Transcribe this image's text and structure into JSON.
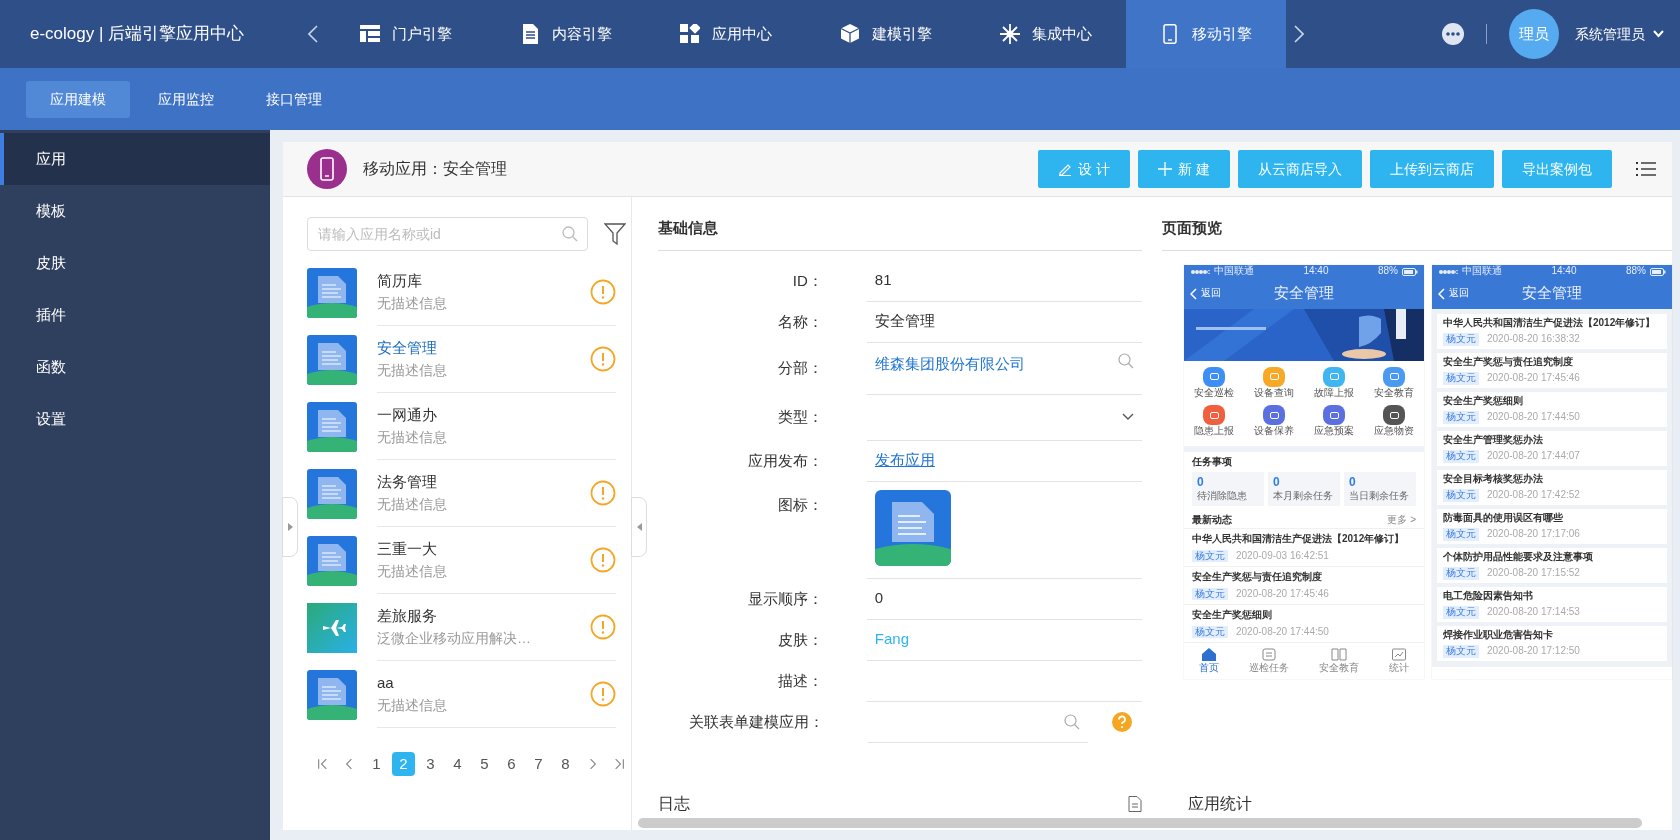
{
  "topbar": {
    "brand": "e-cology | 后端引擎应用中心",
    "avatar": "理员",
    "user": "系统管理员",
    "nav": [
      {
        "label": "门户引擎",
        "selected": false
      },
      {
        "label": "内容引擎",
        "selected": false
      },
      {
        "label": "应用中心",
        "selected": false
      },
      {
        "label": "建模引擎",
        "selected": false
      },
      {
        "label": "集成中心",
        "selected": false
      },
      {
        "label": "移动引擎",
        "selected": true
      }
    ]
  },
  "subnav": [
    {
      "label": "应用建模",
      "selected": true
    },
    {
      "label": "应用监控",
      "selected": false
    },
    {
      "label": "接口管理",
      "selected": false
    }
  ],
  "sidebar": [
    {
      "label": "应用",
      "selected": true
    },
    {
      "label": "模板",
      "selected": false
    },
    {
      "label": "皮肤",
      "selected": false
    },
    {
      "label": "插件",
      "selected": false
    },
    {
      "label": "函数",
      "selected": false
    },
    {
      "label": "设置",
      "selected": false
    }
  ],
  "header": {
    "title": "移动应用：安全管理",
    "buttons": [
      {
        "label": "设 计",
        "kind": "edit"
      },
      {
        "label": "新 建",
        "kind": "add"
      },
      {
        "label": "从云商店导入",
        "kind": "plain"
      },
      {
        "label": "上传到云商店",
        "kind": "plain"
      },
      {
        "label": "导出案例包",
        "kind": "plain"
      }
    ]
  },
  "app_list": {
    "placeholder": "请输入应用名称或id",
    "items": [
      {
        "name": "简历库",
        "desc": "无描述信息",
        "selected": false,
        "kind": "document",
        "warning": true
      },
      {
        "name": "安全管理",
        "desc": "无描述信息",
        "selected": true,
        "kind": "document",
        "warning": true
      },
      {
        "name": "一网通办",
        "desc": "无描述信息",
        "selected": false,
        "kind": "document",
        "warning": false
      },
      {
        "name": "法务管理",
        "desc": "无描述信息",
        "selected": false,
        "kind": "document",
        "warning": true
      },
      {
        "name": "三重一大",
        "desc": "无描述信息",
        "selected": false,
        "kind": "document",
        "warning": true
      },
      {
        "name": "差旅服务",
        "desc": "泛微企业移动应用解决…",
        "selected": false,
        "kind": "plane",
        "warning": true
      },
      {
        "name": "aa",
        "desc": "无描述信息",
        "selected": false,
        "kind": "document",
        "warning": true
      }
    ],
    "pages": [
      {
        "label": "1",
        "selected": false
      },
      {
        "label": "2",
        "selected": true
      },
      {
        "label": "3",
        "selected": false
      },
      {
        "label": "4",
        "selected": false
      },
      {
        "label": "5",
        "selected": false
      },
      {
        "label": "6",
        "selected": false
      },
      {
        "label": "7",
        "selected": false
      },
      {
        "label": "8",
        "selected": false
      }
    ]
  },
  "basic_info": {
    "title": "基础信息",
    "fields": [
      {
        "label": "ID：",
        "kind": "text",
        "value": "81"
      },
      {
        "label": "名称：",
        "kind": "text",
        "value": "安全管理"
      },
      {
        "label": "分部：",
        "kind": "browse",
        "value": "维森集团股份有限公司"
      },
      {
        "label": "类型：",
        "kind": "select"
      },
      {
        "label": "应用发布：",
        "kind": "link",
        "value": "发布应用"
      },
      {
        "label": "图标：",
        "kind": "icon"
      },
      {
        "label": "显示顺序：",
        "kind": "text",
        "value": "0"
      },
      {
        "label": "皮肤：",
        "kind": "skin",
        "value": "Fang"
      },
      {
        "label": "描述：",
        "kind": "text"
      },
      {
        "label": "关联表单建模应用：",
        "kind": "lookup"
      }
    ]
  },
  "preview": {
    "title": "页面预览",
    "phones": [
      {
        "kind": "home",
        "carrier": "中国联通",
        "time": "14:40",
        "battery": "88%",
        "back": "返回",
        "title": "安全管理",
        "shortcuts": [
          {
            "label": "安全巡检",
            "color": "#3d8ef5"
          },
          {
            "label": "设备查询",
            "color": "#f7a827"
          },
          {
            "label": "故障上报",
            "color": "#3fb6f2"
          },
          {
            "label": "安全教育",
            "color": "#4a9af2"
          },
          {
            "label": "隐患上报",
            "color": "#f0603e"
          },
          {
            "label": "设备保养",
            "color": "#5a6fe0"
          },
          {
            "label": "应急预案",
            "color": "#5a6fe0"
          },
          {
            "label": "应急物资",
            "color": "#555555"
          }
        ],
        "tasks_title": "任务事项",
        "tasks": [
          {
            "count": "0",
            "label": "待消除隐患"
          },
          {
            "count": "0",
            "label": "本月剩余任务"
          },
          {
            "count": "0",
            "label": "当日剩余任务"
          }
        ],
        "news_title": "最新动态",
        "more": "更多 >",
        "news": [
          {
            "title": "中华人民共和国清洁生产促进法【2012年修订】",
            "author": "杨文元",
            "date": "2020-09-03 16:42:51"
          },
          {
            "title": "安全生产奖惩与责任追究制度",
            "author": "杨文元",
            "date": "2020-08-20 17:45:46"
          },
          {
            "title": "安全生产奖惩细则",
            "author": "杨文元",
            "date": "2020-08-20 17:44:50"
          }
        ],
        "tabs": [
          {
            "label": "首页",
            "selected": true
          },
          {
            "label": "巡检任务",
            "selected": false
          },
          {
            "label": "安全教育",
            "selected": false
          },
          {
            "label": "统计",
            "selected": false
          }
        ]
      },
      {
        "kind": "list",
        "carrier": "中国联通",
        "time": "14:40",
        "battery": "88%",
        "back": "返回",
        "title": "安全管理",
        "news": [
          {
            "title": "中华人民共和国清洁生产促进法【2012年修订】",
            "author": "杨文元",
            "date": "2020-08-20 16:38:32"
          },
          {
            "title": "安全生产奖惩与责任追究制度",
            "author": "杨文元",
            "date": "2020-08-20 17:45:46"
          },
          {
            "title": "安全生产奖惩细则",
            "author": "杨文元",
            "date": "2020-08-20 17:44:50"
          },
          {
            "title": "安全生产管理奖惩办法",
            "author": "杨文元",
            "date": "2020-08-20 17:44:07"
          },
          {
            "title": "安全目标考核奖惩办法",
            "author": "杨文元",
            "date": "2020-08-20 17:42:52"
          },
          {
            "title": "防毒面具的使用误区有哪些",
            "author": "杨文元",
            "date": "2020-08-20 17:17:06"
          },
          {
            "title": "个体防护用品性能要求及注意事项",
            "author": "杨文元",
            "date": "2020-08-20 17:15:52"
          },
          {
            "title": "电工危险因素告知书",
            "author": "杨文元",
            "date": "2020-08-20 17:14:53"
          },
          {
            "title": "焊接作业职业危害告知卡",
            "author": "杨文元",
            "date": "2020-08-20 17:12:50"
          }
        ]
      }
    ]
  },
  "log": {
    "title": "日志"
  },
  "stats": {
    "title": "应用统计"
  }
}
